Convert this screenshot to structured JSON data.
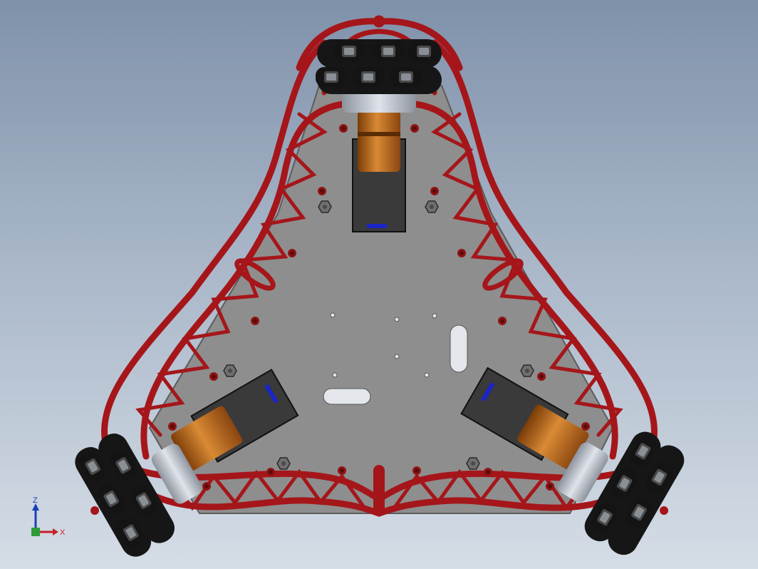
{
  "viewport": {
    "background_top": "#7f91aa",
    "background_bottom": "#d5dde6"
  },
  "model": {
    "frame_color": "#a5161a",
    "frame_highlight": "#d2393d",
    "plate_color": "#8e8e8e",
    "motor_color": "#c06818",
    "bracket_color": "#3a3a3a",
    "wheel_color": "#1a1a1a",
    "hub_color": "#b7bcc6",
    "board_marker_color": "#1a25c8"
  },
  "triad": {
    "z_label": "Z",
    "x_label": "X",
    "z_color": "#1b3fb8",
    "x_color": "#c8202a",
    "y_color": "#2e9b3a"
  }
}
